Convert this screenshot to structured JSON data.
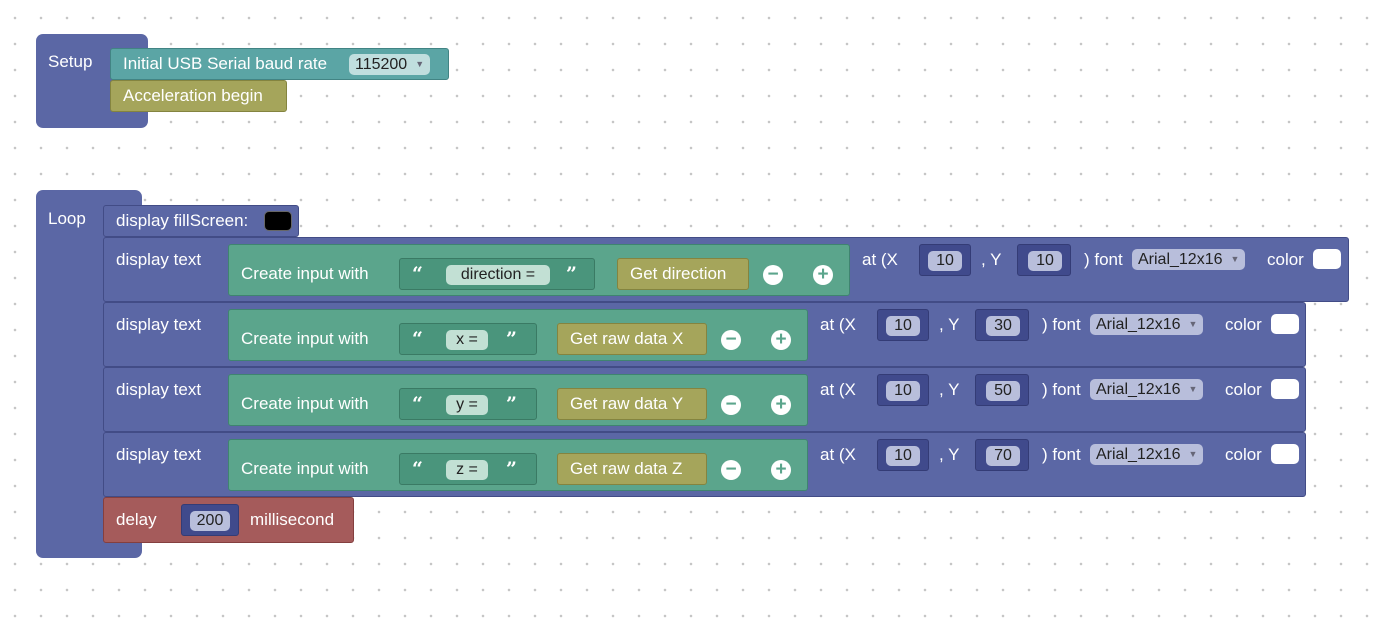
{
  "setup": {
    "label": "Setup",
    "serial_prefix": "Initial USB Serial baud rate",
    "baud_rate": "115200",
    "accel_begin": "Acceleration begin"
  },
  "loop": {
    "label": "Loop",
    "fill_screen": {
      "label": "display fillScreen:",
      "color": "#000000"
    },
    "text_rows": [
      {
        "label": "display text",
        "create": "Create input with",
        "text": "direction =",
        "getter": "Get direction",
        "at_x": "at (X",
        "x": "10",
        "y_label": ", Y",
        "y": "10",
        "font_label": ") font",
        "font": "Arial_12x16",
        "color_label": "color",
        "color": "#ffffff"
      },
      {
        "label": "display text",
        "create": "Create input with",
        "text": "x =",
        "getter": "Get raw data X",
        "at_x": "at (X",
        "x": "10",
        "y_label": ", Y",
        "y": "30",
        "font_label": ") font",
        "font": "Arial_12x16",
        "color_label": "color",
        "color": "#ffffff"
      },
      {
        "label": "display text",
        "create": "Create input with",
        "text": "y =",
        "getter": "Get raw data Y",
        "at_x": "at (X",
        "x": "10",
        "y_label": ", Y",
        "y": "50",
        "font_label": ") font",
        "font": "Arial_12x16",
        "color_label": "color",
        "color": "#ffffff"
      },
      {
        "label": "display text",
        "create": "Create input with",
        "text": "z =",
        "getter": "Get raw data Z",
        "at_x": "at (X",
        "x": "10",
        "y_label": ", Y",
        "y": "70",
        "font_label": ") font",
        "font": "Arial_12x16",
        "color_label": "color",
        "color": "#ffffff"
      }
    ],
    "delay": {
      "label": "delay",
      "value": "200",
      "unit": "millisecond"
    }
  },
  "icons": {
    "open_quote": "“",
    "close_quote": "”",
    "minus": "−",
    "plus": "+",
    "dropdown": "▼"
  },
  "colors": {
    "procedure": "#5b67a5",
    "serial": "#5ba5a5",
    "sensor": "#a5a55b",
    "text": "#5ba58c",
    "delay": "#a55b5b"
  }
}
